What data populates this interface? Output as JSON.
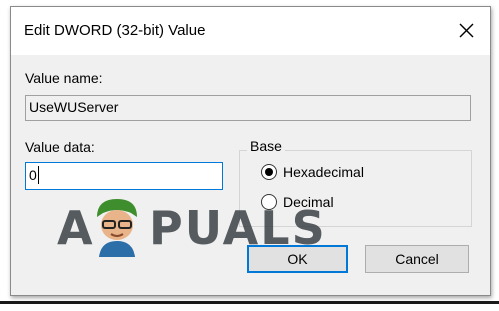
{
  "dialog": {
    "title": "Edit DWORD (32-bit) Value",
    "close_icon": "close-icon"
  },
  "value_name": {
    "label": "Value name:",
    "value": "UseWUServer"
  },
  "value_data": {
    "label": "Value data:",
    "value": "0"
  },
  "base": {
    "label": "Base",
    "options": [
      {
        "label": "Hexadecimal",
        "selected": true
      },
      {
        "label": "Decimal",
        "selected": false
      }
    ]
  },
  "buttons": {
    "ok": "OK",
    "cancel": "Cancel"
  },
  "watermark": {
    "text_a": "A",
    "text_rest": "PUALS",
    "mascot_icon": "mascot-icon"
  },
  "colors": {
    "accent": "#0078d7",
    "dialog_bg": "#f0f0f0"
  }
}
